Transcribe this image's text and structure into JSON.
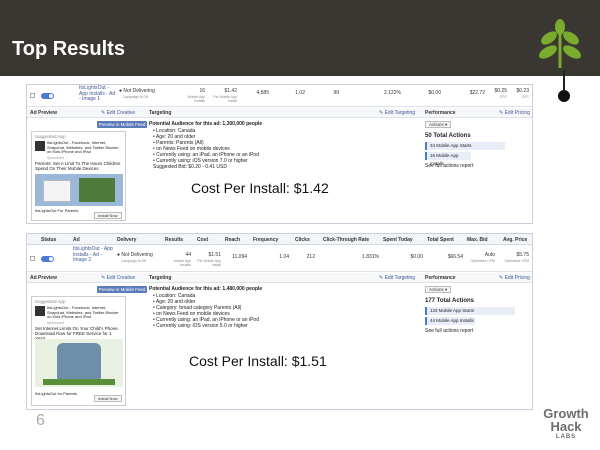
{
  "slide": {
    "title": "Top Results",
    "page_number": "6"
  },
  "brand": {
    "line1": "Growth",
    "line2": "Hack",
    "line3": "LABS",
    "accent_color": "#7bab2e",
    "header_color": "#3a3733"
  },
  "row1": {
    "ad_name": "ItsLightsOut - App Installs - Ad - Image 1",
    "delivery": "Not Delivering",
    "delivery_sub": "Campaign is Off",
    "results": "16",
    "results_sub": "Mobile App Installs",
    "cost": "$1.42",
    "cost_sub": "Per Mobile App Install",
    "reach": "4,585",
    "frequency": "1.02",
    "clicks": "99",
    "ctr": "2.122%",
    "spent_today": "$0.00",
    "total_spent": "$22.72",
    "max_bid": "$0.25",
    "max_bid_sub": "CPC",
    "avg_price": "$0.23",
    "avg_price_sub": "CPC"
  },
  "section1": {
    "ad_preview": "Ad Preview",
    "edit_creative": "Edit Creative",
    "preview_button": "Preview in Mobile Feed",
    "targeting": "Targeting",
    "edit_targeting": "Edit Targeting",
    "performance": "Performance",
    "edit_pricing": "Edit Pricing",
    "audience": "Potential Audience for this ad: 1,300,000 people",
    "criteria": [
      "Location: Canada",
      "Age: 20 and older",
      "Parents: Parents (All)",
      "on News Feed on mobile devices",
      "Currently using: an iPad, an iPhone or an iPod",
      "Currently using: iOS version 7.0 or higher"
    ],
    "suggested_bid": "Suggested Bid: $0.20 - 0.41 USD",
    "actions_button": "Actions",
    "total_actions": "50 Total Actions",
    "bars": [
      "34 Mobile App Starts",
      "16 Mobile App Installs"
    ],
    "report_link": "See full actions report",
    "ad": {
      "label": "Suggested App",
      "name": "ItsLightsOut - Facebook, Internet, Snapchat, Websites, and Twitter Blocker on Kids iPhone and iPad",
      "sponsored": "Sponsored",
      "body": "Parents: Set A Limit To The Hours Children Spend On Their Mobile Devices",
      "footer": "ItsLightsOut For Parents",
      "install": "Install Now"
    },
    "big_label": "Cost Per Install: $1.42"
  },
  "table2": {
    "headers": [
      "Status",
      "Ad",
      "Delivery",
      "Results",
      "Cost",
      "Reach",
      "Frequency",
      "Clicks",
      "Click-Through Rate",
      "Spent Today",
      "Total Spent",
      "Max. Bid",
      "Avg. Price"
    ]
  },
  "row2": {
    "ad_name": "ItsLightsOut - App Installs - Ad - Image 2",
    "delivery": "Not Delivering",
    "delivery_sub": "Campaign is Off",
    "results": "44",
    "results_sub": "Mobile App Installs",
    "cost": "$1.51",
    "cost_sub": "Per Mobile App Install",
    "reach": "11,094",
    "frequency": "1.04",
    "clicks": "212",
    "ctr": "1.831%",
    "spent_today": "$0.00",
    "total_spent": "$66.54",
    "max_bid": "Auto",
    "max_bid_sub": "Optimized CPM",
    "avg_price": "$5.75",
    "avg_price_sub": "Optimized CPM"
  },
  "section2": {
    "ad_preview": "Ad Preview",
    "edit_creative": "Edit Creative",
    "preview_button": "Preview in Mobile Feed",
    "targeting": "Targeting",
    "edit_targeting": "Edit Targeting",
    "performance": "Performance",
    "edit_pricing": "Edit Pricing",
    "audience": "Potential Audience for this ad: 1,480,000 people",
    "criteria": [
      "Location: Canada",
      "Age: 20 and older",
      "Category: broad category Parents (All)",
      "on News Feed on mobile devices",
      "Currently using: an iPad, an iPhone or an iPod",
      "Currently using: iOS version 5.0 or higher"
    ],
    "actions_button": "Actions",
    "total_actions": "177 Total Actions",
    "bars": [
      "133 Mobile App Starts",
      "44 Mobile App Installs"
    ],
    "report_link": "See full actions report",
    "ad": {
      "label": "Suggested App",
      "name": "ItsLightsOut - Facebook, Internet, Snapchat, Websites, and Twitter Blocker on Kids iPhone and iPad",
      "sponsored": "Sponsored",
      "body": "Set Internet Limits On Your Child's Phone. Download Now for FREE Service for 1 Year!",
      "footer": "ItsLightsOut for Parents",
      "install": "Install Now"
    },
    "big_label": "Cost Per Install: $1.51"
  }
}
